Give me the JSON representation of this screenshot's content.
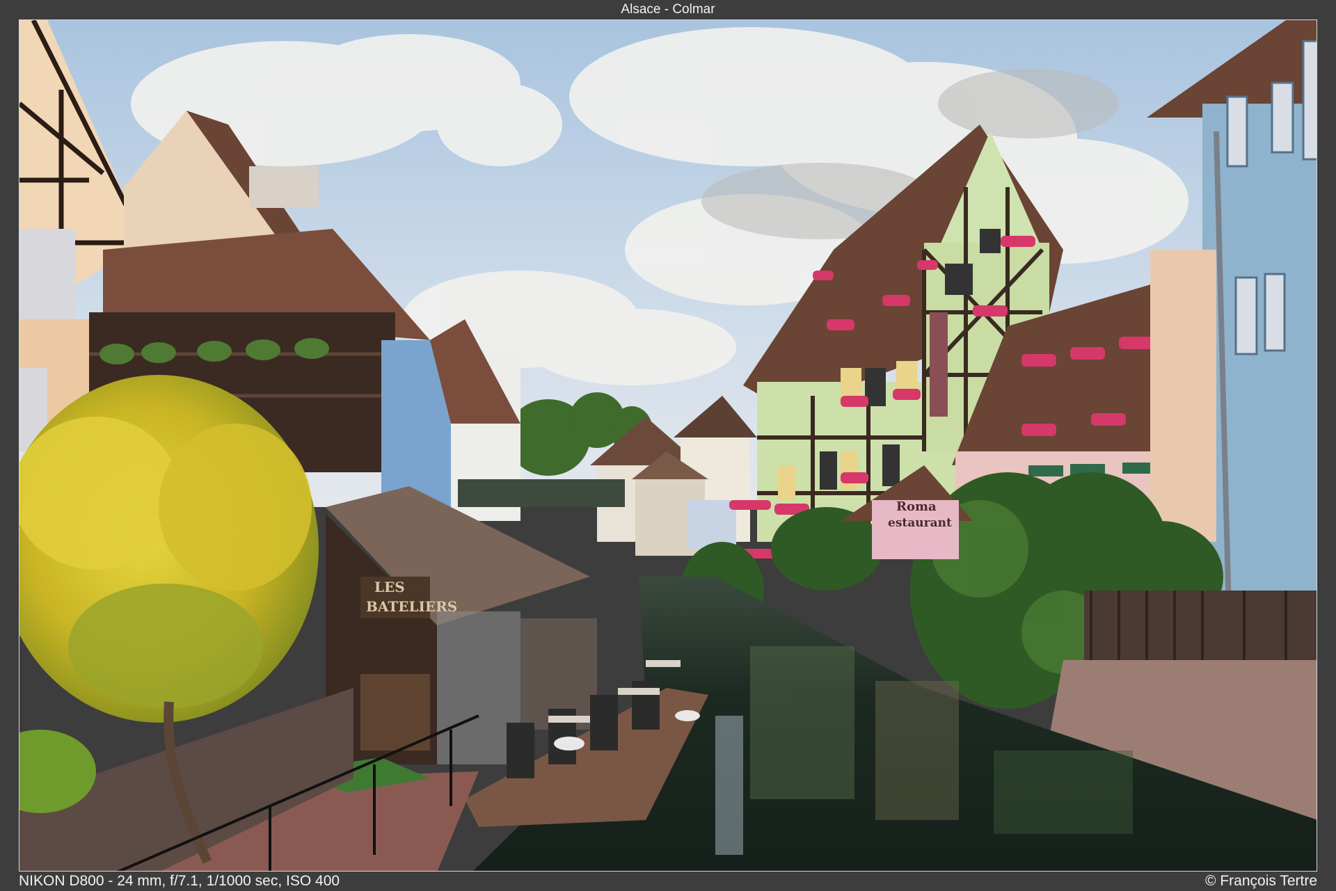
{
  "header": {
    "title": "Alsace - Colmar"
  },
  "photo": {
    "signs": {
      "bateliers_line1": "LES",
      "bateliers_line2": "BATELIERS",
      "restaurant_line1": "Roma",
      "restaurant_line2": "estaurant"
    },
    "colors": {
      "sky": "#b8cfe6",
      "cloud": "#f2f2f0",
      "water": "#1f2e26",
      "tree_yellow": "#d8c22a",
      "foliage_green": "#2f5a25",
      "green_house": "#c9dfaa",
      "blue_house": "#8fb3cc",
      "roof_brown": "#6a4434",
      "flowers": "#d6386a"
    }
  },
  "footer": {
    "camera_info": "NIKON D800 - 24 mm, f/7.1, 1/1000 sec, ISO 400",
    "copyright": "© François Tertre"
  }
}
